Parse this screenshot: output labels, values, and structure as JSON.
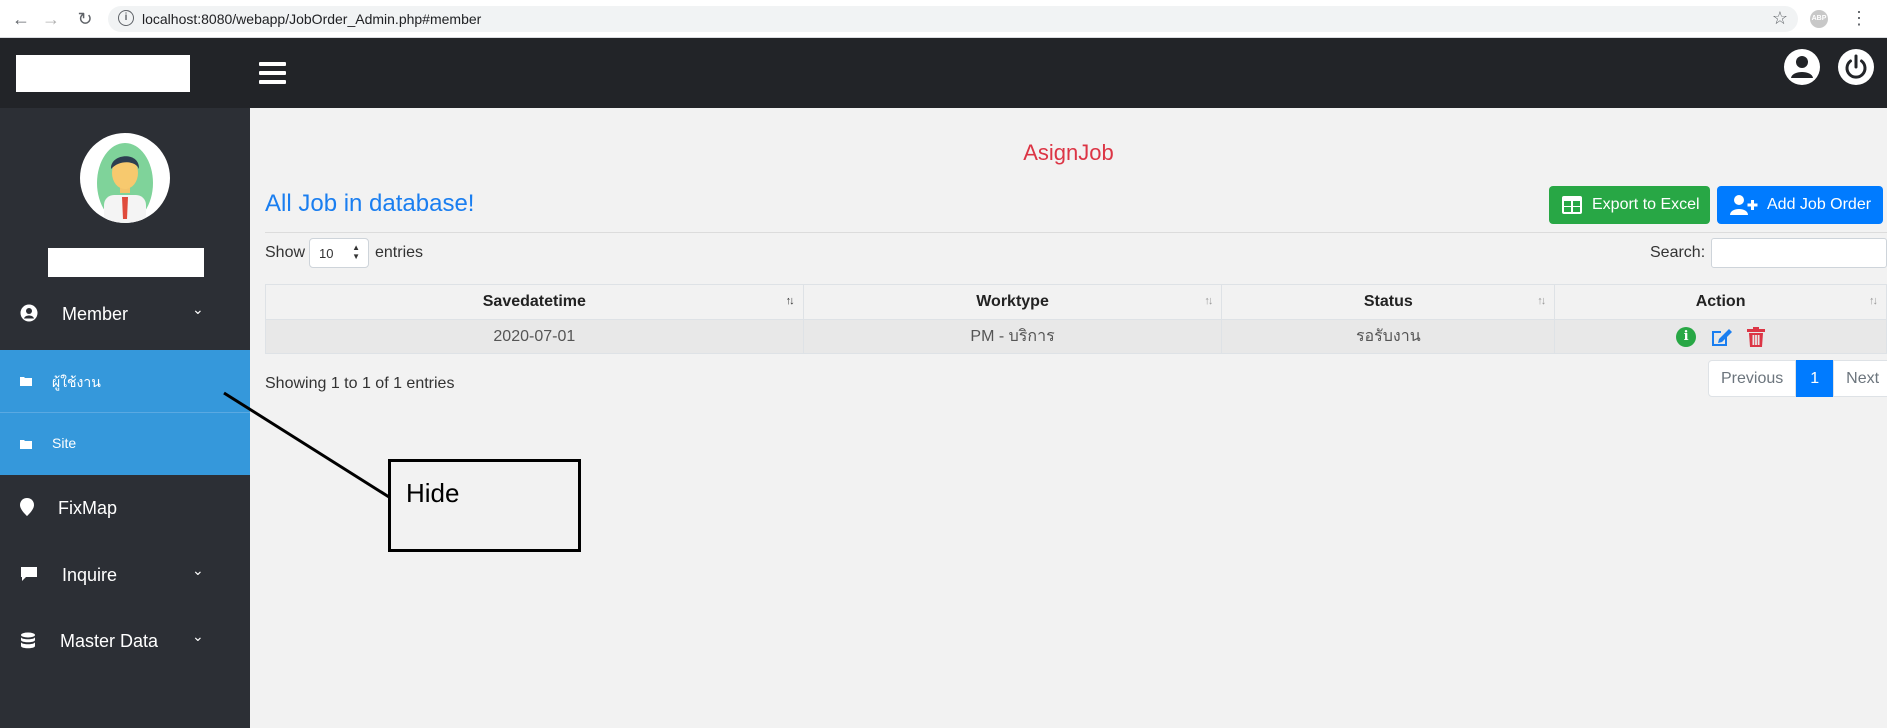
{
  "browser": {
    "url": "localhost:8080/webapp/JobOrder_Admin.php#member",
    "abp": "ABP"
  },
  "sidebar": {
    "items": [
      {
        "label": "Member",
        "icon": "user-circle-icon",
        "expandable": true
      },
      {
        "label": "ผู้ใช้งาน",
        "icon": "folder-icon"
      },
      {
        "label": "Site",
        "icon": "folder-icon"
      },
      {
        "label": "FixMap",
        "icon": "map-marker-icon"
      },
      {
        "label": "Inquire",
        "icon": "comment-icon",
        "expandable": true
      },
      {
        "label": "Master Data",
        "icon": "database-icon",
        "expandable": true
      }
    ]
  },
  "main": {
    "heading": "AsignJob",
    "section_title": "All Job in database!",
    "export_label": "Export to Excel",
    "add_label": "Add Job Order",
    "show_label": "Show",
    "page_size": "10",
    "entries_label": "entries",
    "search_label": "Search:",
    "search_value": "",
    "table": {
      "headers": [
        "Savedatetime",
        "Worktype",
        "Status",
        "Action"
      ],
      "rows": [
        {
          "savedatetime": "2020-07-01",
          "worktype": "PM - บริการ",
          "status": "รอรับงาน"
        }
      ]
    },
    "showing_text": "Showing 1 to 1 of 1 entries",
    "pagination": {
      "previous": "Previous",
      "current": "1",
      "next": "Next"
    }
  },
  "annotation": {
    "text": "Hide"
  },
  "colors": {
    "topbar": "#222428",
    "sidebar": "#2c2f35",
    "sidebar_active": "#3598db",
    "heading": "#dc3545",
    "title": "#1a7ef0",
    "success": "#28a745",
    "primary": "#007bff",
    "danger": "#dc3545"
  }
}
